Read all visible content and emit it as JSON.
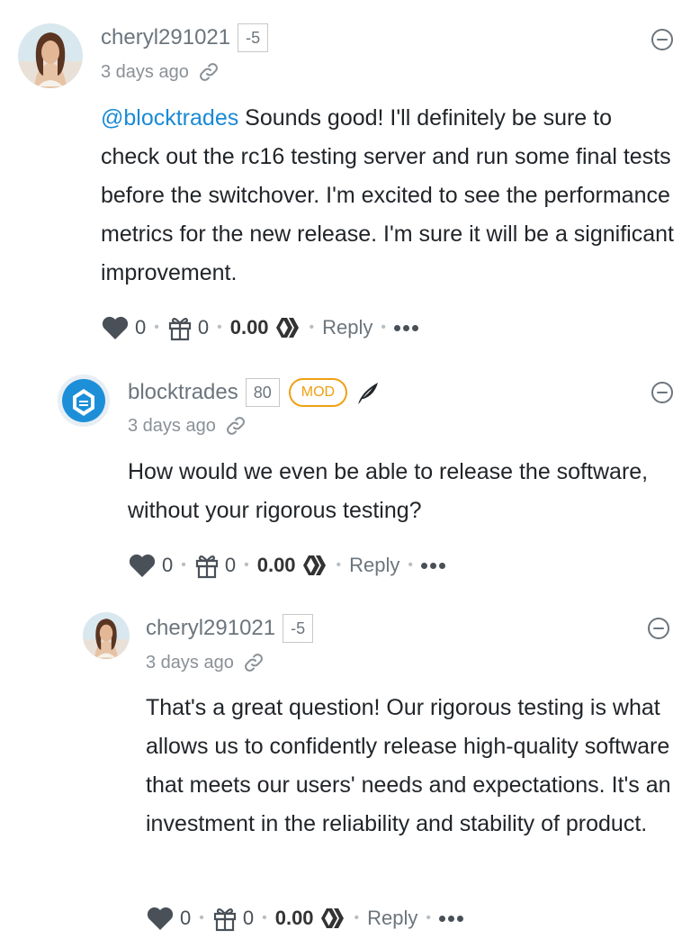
{
  "comments": [
    {
      "author": "cheryl291021",
      "reputation": "-5",
      "time": "3 days ago",
      "mention": "@blocktrades",
      "text": " Sounds good! I'll definitely be sure to check out the rc16 testing server and run some final tests before the switchover. I'm excited to see the performance metrics for the new release. I'm sure it will be a significant improvement.",
      "votes": "0",
      "gifts": "0",
      "payout": "0.00",
      "reply_label": "Reply"
    },
    {
      "author": "blocktrades",
      "reputation": "80",
      "badge": "MOD",
      "time": "3 days ago",
      "text": "How would we even be able to release the software, without your rigorous testing?",
      "votes": "0",
      "gifts": "0",
      "payout": "0.00",
      "reply_label": "Reply"
    },
    {
      "author": "cheryl291021",
      "reputation": "-5",
      "time": "3 days ago",
      "text": "That's a great question! Our rigorous testing is what allows us to confidently release high-quality software that meets our users' needs and expectations. It's an investment in the reliability and stability of product.",
      "votes": "0",
      "gifts": "0",
      "payout": "0.00",
      "reply_label": "Reply"
    }
  ],
  "colors": {
    "mention": "#1a8ad6",
    "mod_badge": "#f0a012",
    "muted": "#6c757d"
  },
  "icons": {
    "collapse": "minus-circle-icon",
    "link": "link-icon",
    "upvote": "heart-icon",
    "gift": "gift-icon",
    "hive": "hive-logo-icon",
    "more": "ellipsis-icon",
    "quill": "quill-icon"
  }
}
